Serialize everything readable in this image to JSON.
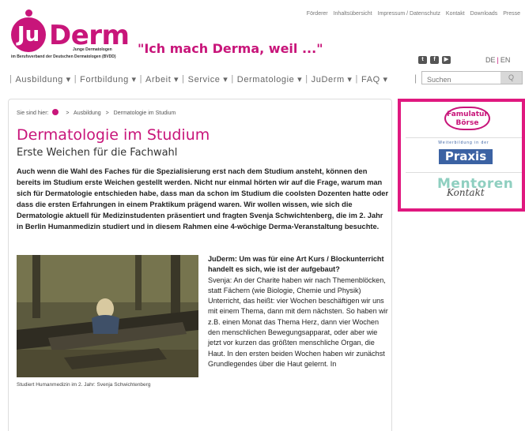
{
  "brand": {
    "logo_letters": "Ju",
    "logo_word": "Derm",
    "sub_line1": "Junge Dermatologen",
    "sub_line2": "im Berufsverband der Deutschen Dermatologen (BVDD)",
    "slogan": "\"Ich mach Derma, weil ...\"",
    "accent": "#c8157a"
  },
  "toplinks": [
    "Förderer",
    "Inhaltsübersicht",
    "Impressum / Datenschutz",
    "Kontakt",
    "Downloads",
    "Presse"
  ],
  "social": {
    "icons": [
      "twitter-icon",
      "facebook-icon",
      "youtube-icon"
    ]
  },
  "lang": {
    "de": "DE",
    "en": "EN"
  },
  "nav": {
    "items": [
      "Ausbildung",
      "Fortbildung",
      "Arbeit",
      "Service",
      "Dermatologie",
      "JuDerm",
      "FAQ"
    ],
    "caret": "▾"
  },
  "search": {
    "placeholder": "Suchen",
    "button": "Q"
  },
  "breadcrumb": {
    "prefix": "Sie sind hier:",
    "sep": ">",
    "items": [
      "Ausbildung",
      "Dermatologie im Studium"
    ]
  },
  "article": {
    "title": "Dermatologie im Studium",
    "subtitle": "Erste Weichen für die Fachwahl",
    "lead": "Auch wenn die Wahl des Faches für die Spezialisierung erst nach dem Studium ansteht, können den bereits im Studium erste Weichen gestellt werden. Nicht nur einmal hörten wir auf die Frage, warum man sich für Dermatologie entschieden habe, dass man da schon im Studium die coolsten Dozenten hatte oder dass die ersten Erfahrungen in einem Praktikum prägend waren. Wir wollen wissen, wie sich die Dermatologie aktuell für Medizinstudenten präsentiert und fragten Svenja Schwichtenberg, die im 2. Jahr in Berlin Humanmedizin studiert und in diesem Rahmen eine 4-wöchige Derma-Veranstaltung besuchte.",
    "caption": "Studiert Humanmedizin im 2. Jahr: Svenja Schwichtenberg",
    "question": "JuDerm: Um was für eine Art Kurs / Blockunterricht handelt es sich, wie ist der aufgebaut?",
    "answer": "Svenja: An der Charite haben wir nach Themenblöcken, statt Fächern (wie Biologie, Chemie und Physik) Unterricht, das heißt: vier Wochen beschäftigen wir uns mit einem Thema, dann mit dem nächsten. So haben wir z.B. einen Monat das Thema Herz, dann vier Wochen den menschlichen Bewegungsapparat, oder aber wie jetzt vor kurzen das größten menschliche Organ, die Haut. In den ersten beiden Wochen haben wir zunächst Grundlegendes über die Haut gelernt. In"
  },
  "sidebar": {
    "famulatur_line1": "Famulatur",
    "famulatur_line2": "Börse",
    "wb_text": "Weiterbildung in der",
    "praxis": "Praxis",
    "mentoren": "Mentoren",
    "kontakt": "Kontakt",
    "border_color": "#e0187f"
  }
}
